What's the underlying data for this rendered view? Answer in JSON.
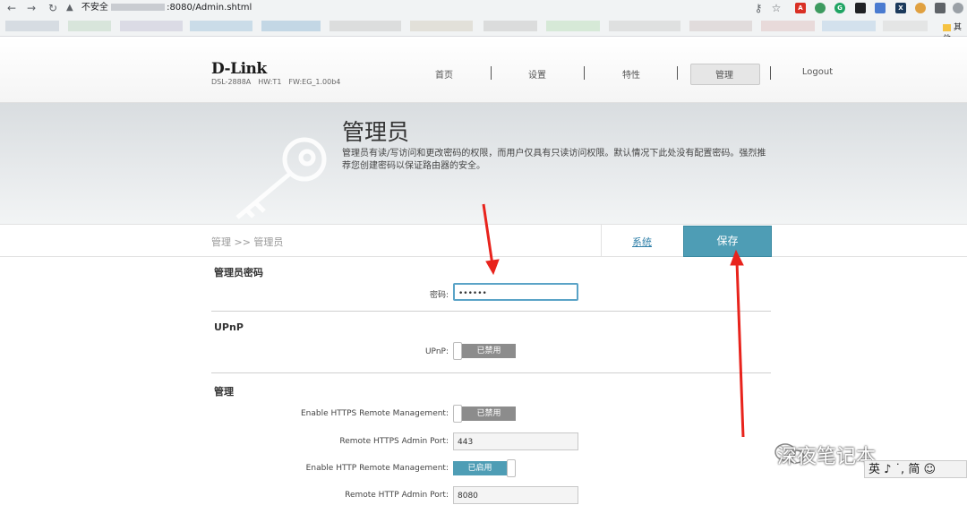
{
  "browser": {
    "security": "不安全",
    "url": ":8080/Admin.shtml",
    "bookmark_folder": "其他"
  },
  "header": {
    "brand": "D-Link",
    "model": "DSL-2888A",
    "hw": "HW:T1",
    "fw": "FW:EG_1.00b4",
    "menu": [
      "首页",
      "设置",
      "特性",
      "管理",
      "Logout"
    ],
    "active_menu": "管理"
  },
  "banner": {
    "title": "管理员",
    "description": "管理员有读/写访问和更改密码的权限，而用户仅具有只读访问权限。默认情况下此处没有配置密码。强烈推荐您创建密码以保证路由器的安全。"
  },
  "crumbs": {
    "path": "管理 >> 管理员",
    "link": "系统",
    "save": "保存"
  },
  "sections": {
    "password": {
      "title": "管理员密码",
      "label": "密码:",
      "value": "••••••"
    },
    "upnp": {
      "title": "UPnP",
      "label": "UPnP:",
      "state": "已禁用"
    },
    "manage": {
      "title": "管理",
      "https_label": "Enable HTTPS Remote Management:",
      "https_state": "已禁用",
      "https_port_label": "Remote HTTPS Admin Port:",
      "https_port": "443",
      "http_label": "Enable HTTP Remote Management:",
      "http_state": "已启用",
      "http_port_label": "Remote HTTP Admin Port:",
      "http_port": "8080"
    }
  },
  "overlay": {
    "watermark": "深夜笔记本",
    "ime": "英 ♪ ˙, 简 ☺"
  },
  "colors": {
    "accent": "#4e9db5",
    "arrow": "#e8231c",
    "disabled_toggle": "#8c8c8c"
  }
}
